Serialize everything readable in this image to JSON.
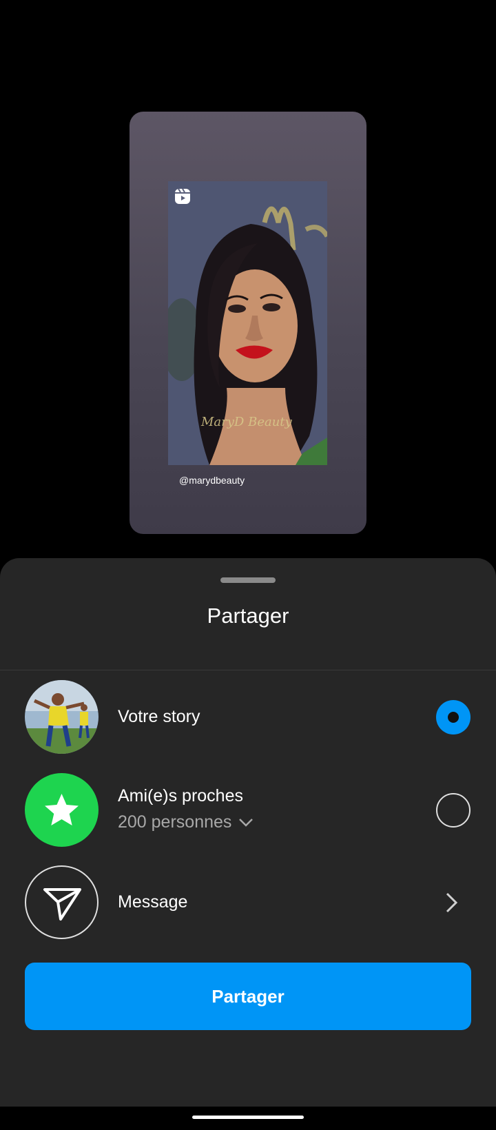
{
  "story_preview": {
    "reel_icon": "reels-icon",
    "author_handle": "@marydbeauty",
    "watermark_text": "MaryD Beauty"
  },
  "sheet": {
    "title": "Partager",
    "options": [
      {
        "label": "Votre story",
        "avatar": "profile-photo",
        "state": "selected"
      },
      {
        "label": "Ami(e)s proches",
        "sublabel": "200 personnes",
        "avatar": "star-icon",
        "state": "unselected"
      },
      {
        "label": "Message",
        "avatar": "paper-plane-icon",
        "state": "chevron"
      }
    ],
    "primary_button": "Partager"
  },
  "colors": {
    "accent": "#0095f6",
    "close_friends_green": "#1ed44f",
    "sheet_background": "#262626"
  }
}
